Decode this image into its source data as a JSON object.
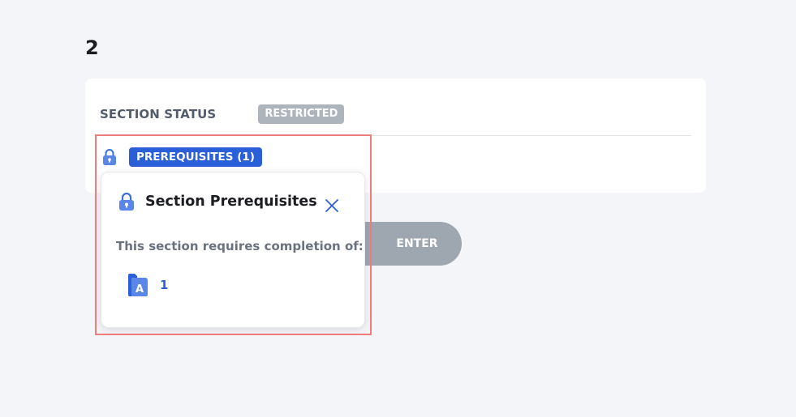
{
  "section": {
    "number": "2"
  },
  "status": {
    "label": "SECTION STATUS",
    "badge": "RESTRICTED",
    "badge_color": "#aeb4bc"
  },
  "prerequisites": {
    "badge": "PREREQUISITES (1)",
    "badge_color": "#2a5fd8",
    "icon": "lock-icon"
  },
  "enter_button": {
    "label": "ENTER",
    "color": "#9ea7b0"
  },
  "popover": {
    "title": "Section Prerequisites",
    "icon": "lock-icon",
    "close_icon": "close-icon",
    "description": "This section requires completion of:",
    "items": [
      {
        "icon": "folder-a-icon",
        "label": "1"
      }
    ]
  },
  "colors": {
    "accent": "#2a5fd8",
    "highlight_outline": "#ef7c7c",
    "background": "#f4f5f8"
  }
}
